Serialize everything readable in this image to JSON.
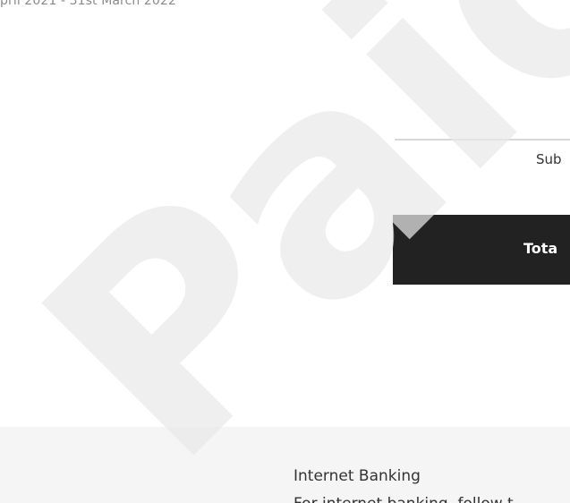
{
  "invoice": {
    "period": "pril 2021 - 31st March 2022"
  },
  "totals": {
    "subtotal_label": "Sub",
    "total_label": "Tota"
  },
  "payment": {
    "method_title": "Internet Banking",
    "method_text": "For internet banking, follow t"
  },
  "stamp": {
    "text": "Paid",
    "color": "#e9e9e9"
  }
}
